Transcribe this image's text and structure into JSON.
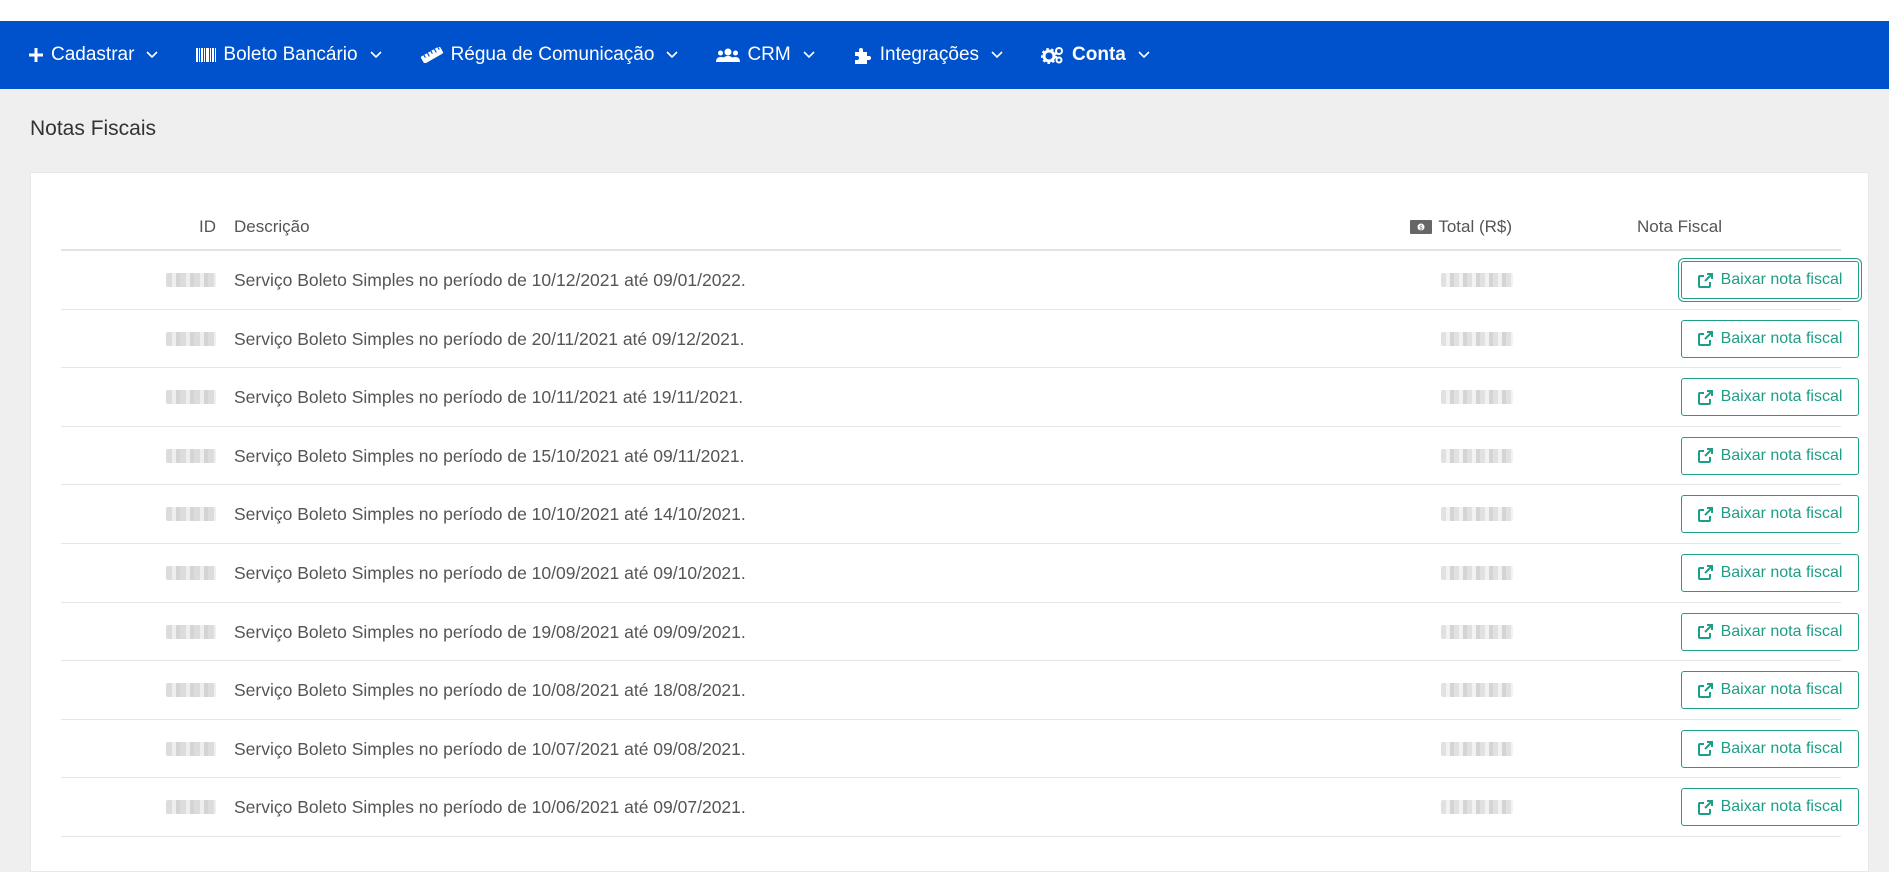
{
  "nav": {
    "items": [
      {
        "label": "Cadastrar"
      },
      {
        "label": "Boleto Bancário"
      },
      {
        "label": "Régua de Comunicação"
      },
      {
        "label": "CRM"
      },
      {
        "label": "Integrações"
      },
      {
        "label": "Conta"
      }
    ]
  },
  "page": {
    "title": "Notas Fiscais"
  },
  "table": {
    "headers": {
      "id": "ID",
      "descricao": "Descrição",
      "total": "Total (R$)",
      "nota_fiscal": "Nota Fiscal"
    },
    "button_label": "Baixar nota fiscal",
    "rows": [
      {
        "descricao": "Serviço Boleto Simples no período de 10/12/2021 até 09/01/2022."
      },
      {
        "descricao": "Serviço Boleto Simples no período de 20/11/2021 até 09/12/2021."
      },
      {
        "descricao": "Serviço Boleto Simples no período de 10/11/2021 até 19/11/2021."
      },
      {
        "descricao": "Serviço Boleto Simples no período de 15/10/2021 até 09/11/2021."
      },
      {
        "descricao": "Serviço Boleto Simples no período de 10/10/2021 até 14/10/2021."
      },
      {
        "descricao": "Serviço Boleto Simples no período de 10/09/2021 até 09/10/2021."
      },
      {
        "descricao": "Serviço Boleto Simples no período de 19/08/2021 até 09/09/2021."
      },
      {
        "descricao": "Serviço Boleto Simples no período de 10/08/2021 até 18/08/2021."
      },
      {
        "descricao": "Serviço Boleto Simples no período de 10/07/2021 até 09/08/2021."
      },
      {
        "descricao": "Serviço Boleto Simples no período de 10/06/2021 até 09/07/2021."
      }
    ]
  },
  "colors": {
    "navbar": "#0052cc",
    "accent": "#1e9e86",
    "background": "#efefef"
  }
}
